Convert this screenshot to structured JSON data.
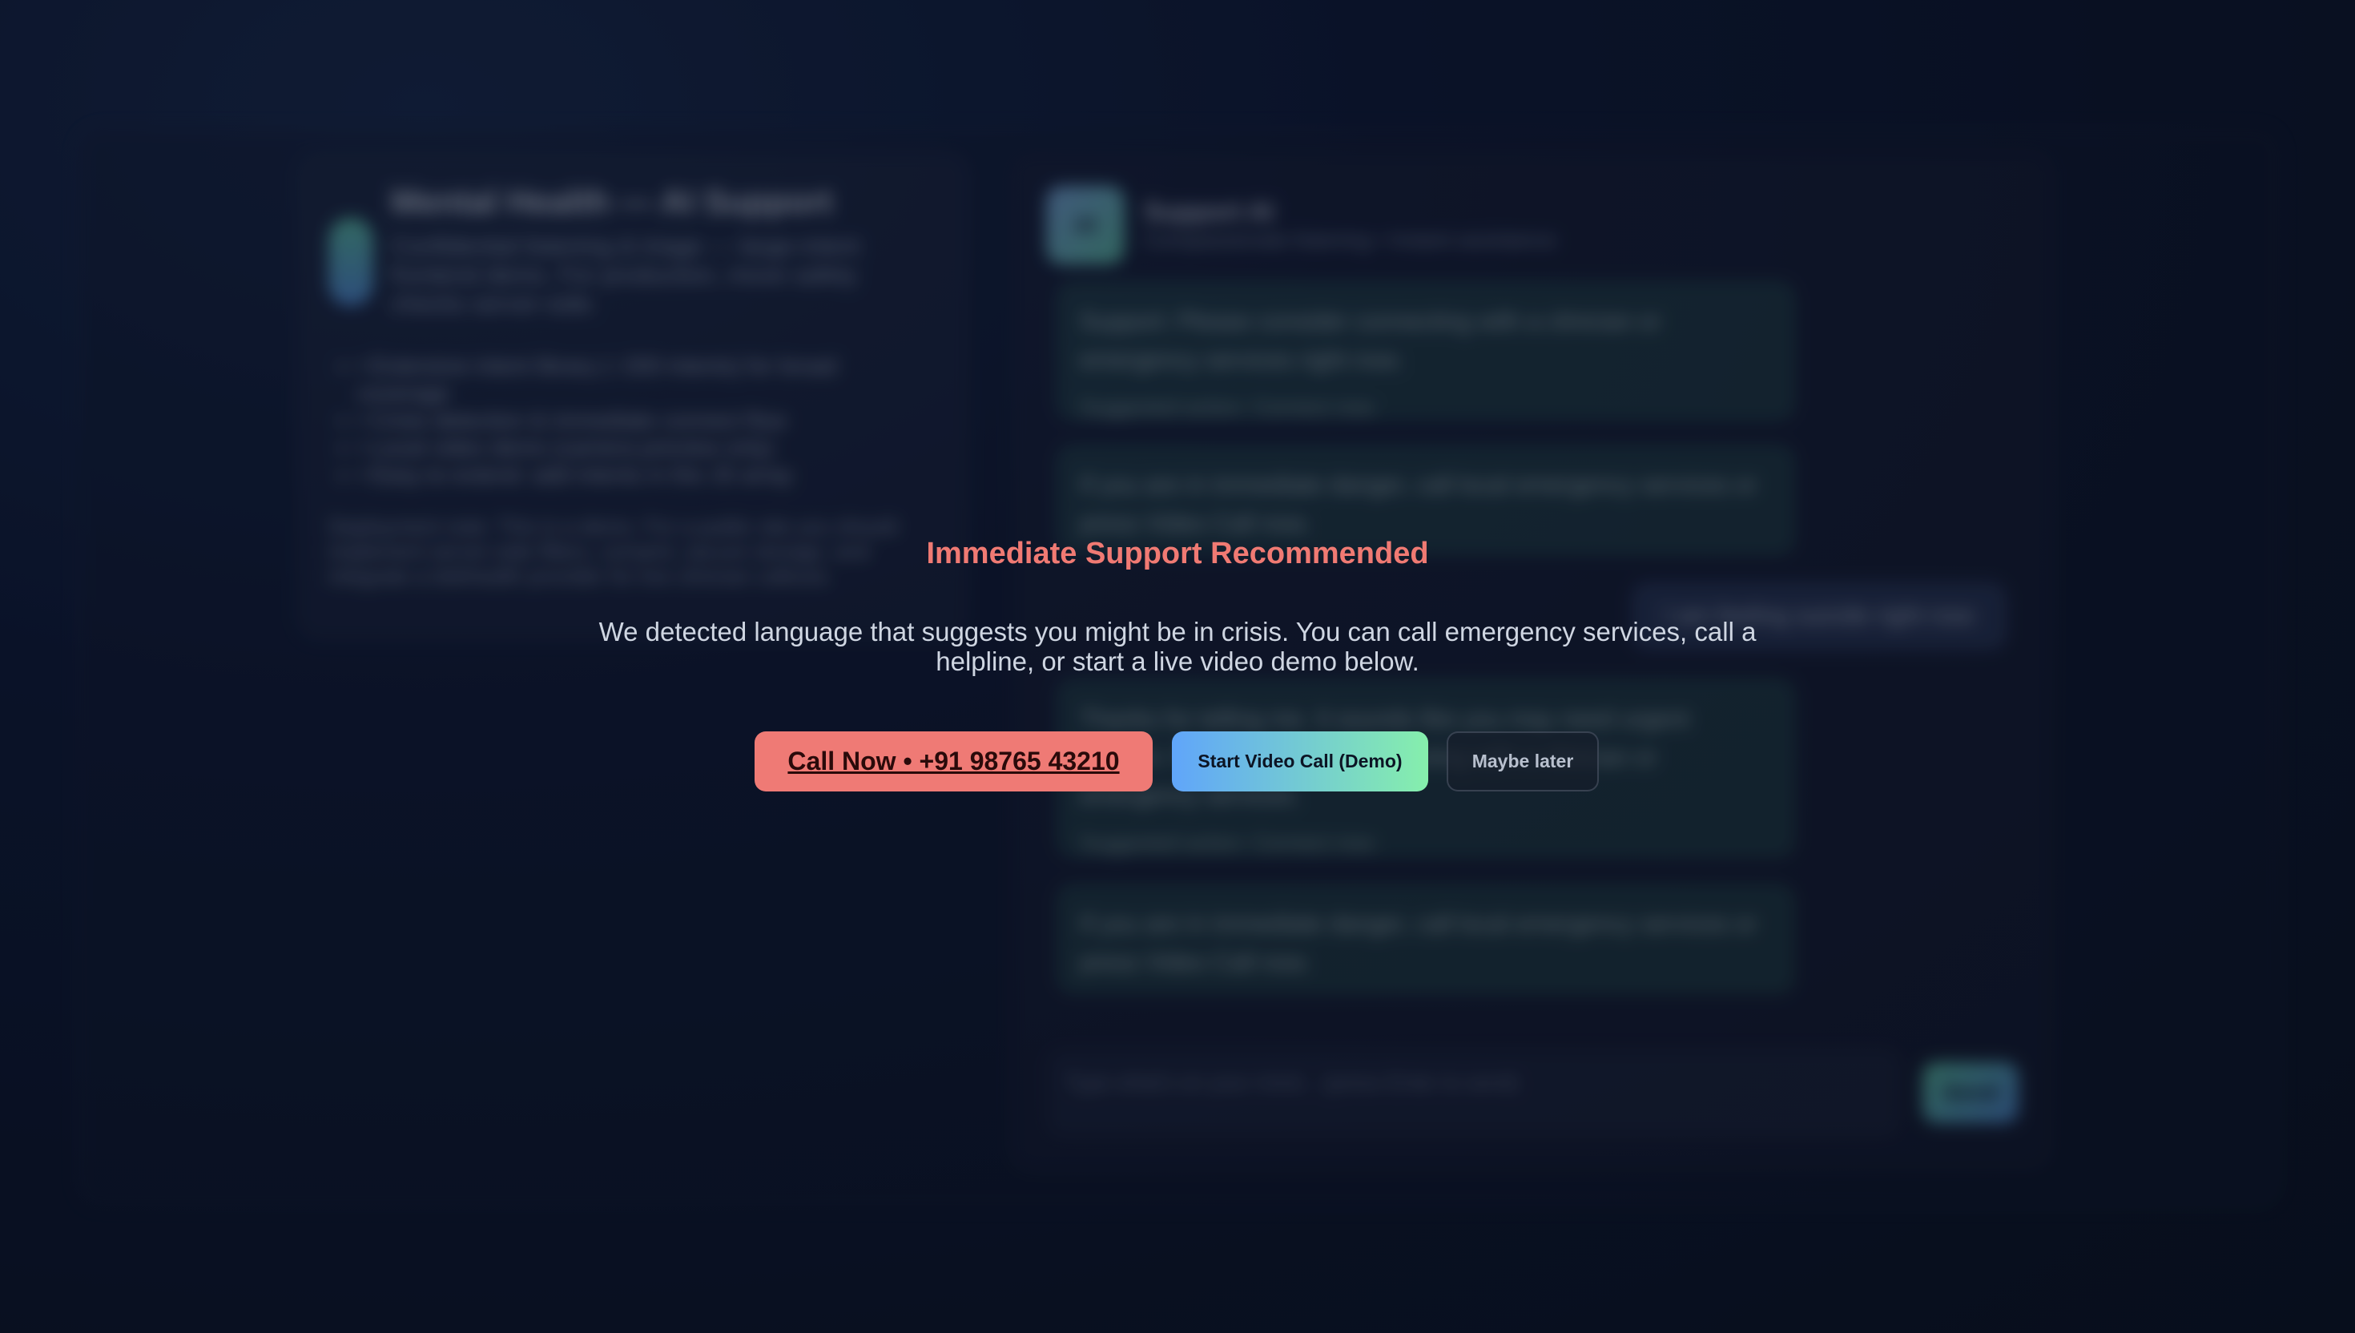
{
  "background": {
    "left_panel": {
      "title": "Mental Health — AI Support",
      "subtitle": "Confidential listening & triage — large-intent frontend demo. For production, move safety checks server-side.",
      "features": [
        "• Extensive intent library (~200 intents) for broad coverage",
        "• Crisis detection & immediate connect flow",
        "• Local video demo (camera preview only)",
        "• Easy to extend: add intents in the JS array"
      ],
      "deployment_note": "Deployment note: This is a demo. For a public site you should implement server-side filters, consent, secure storage, and integrate a telehealth provider for live clinician callouts."
    },
    "chat": {
      "avatar_label": "AI",
      "assistant_name": "Support AI",
      "assistant_status": "Compassionate listening • Instant assistance",
      "messages": [
        {
          "text": "Support: Please consider connecting with a clinician or emergency services right now.",
          "action": "Suggested action: Connect now"
        },
        {
          "text": "If you are in immediate danger, call local emergency services or press Video Call now.",
          "action": ""
        },
        {
          "text": "Thanks for telling me. It sounds like you may need urgent support. Please consider connecting with a clinician or emergency services.",
          "action": "Suggested action: Connect now"
        },
        {
          "text": "If you are in immediate danger, call local emergency services or press Video Call now.",
          "action": ""
        }
      ],
      "user_message": "I am feeling suicide right now",
      "input_placeholder": "Type what's on your mind... (press Enter to send)",
      "send_label": "Send"
    }
  },
  "modal": {
    "title": "Immediate Support Recommended",
    "body": "We detected language that suggests you might be in crisis. You can call emergency services, call a helpline, or start a live video demo below.",
    "call_button": "Call Now • +91 98765 43210",
    "video_button": "Start Video Call (Demo)",
    "later_button": "Maybe later"
  },
  "colors": {
    "accent_red": "#ef7a75",
    "title_red": "#f07a73",
    "gradient_blue": "#60a5fa",
    "gradient_green": "#86efac"
  }
}
